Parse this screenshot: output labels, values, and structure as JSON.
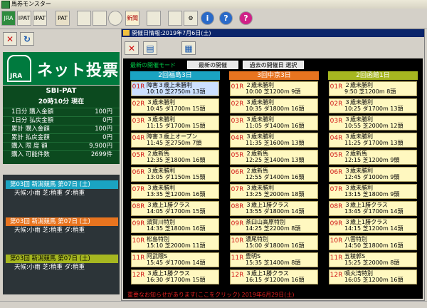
{
  "window": {
    "title": "馬券モンスター"
  },
  "toolbar": {
    "items": [
      {
        "name": "jra-icon",
        "label": "JRA"
      },
      {
        "name": "ipat-icon",
        "label": "IPAT"
      },
      {
        "name": "ipat2-icon",
        "label": "IPAT"
      },
      {
        "name": "pat-icon",
        "label": "PAT"
      },
      {
        "name": "stamp-icon",
        "label": ""
      },
      {
        "name": "printer-icon",
        "label": ""
      },
      {
        "name": "clock-icon",
        "label": ""
      },
      {
        "name": "newspaper-icon",
        "label": "新聞"
      },
      {
        "name": "camera-icon",
        "label": ""
      },
      {
        "name": "save-disk-icon",
        "label": ""
      },
      {
        "name": "gear-icon",
        "label": ""
      },
      {
        "name": "info-icon",
        "label": "i"
      },
      {
        "name": "help-icon",
        "label": "?"
      }
    ]
  },
  "brand": {
    "logo": "JRA",
    "title": "ネット投票"
  },
  "account": {
    "name": "SBI-PAT",
    "time": "20時10分 現在",
    "rows": [
      {
        "label": "1日分 購入金額",
        "value": "100円"
      },
      {
        "label": "1日分 払戻金額",
        "value": "0円"
      },
      {
        "label": "累計 購入金額",
        "value": "100円"
      },
      {
        "label": "累計 払戻金額",
        "value": "0円"
      },
      {
        "label": "購入 限 度 額",
        "value": "9,900円"
      },
      {
        "label": "購入 可能件数",
        "value": "2699件"
      }
    ]
  },
  "racecards": [
    {
      "title": "第03回 新潟競馬 第07日 (土)",
      "weather": "天候:小雨 芝:稍重 ダ:稍重"
    },
    {
      "title": "第03回 新潟競馬 第07日 (土)",
      "weather": "天候:小雨 芝:稍重 ダ:稍重"
    },
    {
      "title": "第03回 新潟競馬 第07日 (土)",
      "weather": "天候:小雨 芝:稍重 ダ:稍重"
    }
  ],
  "child": {
    "title": "開催日情報:2019年7月6日(土)",
    "mode_label": "最新の開催モード",
    "btn_latest": "最新の開催",
    "btn_past": "過去の開催日 選択",
    "notice": "重要なお知らせがあります(ここをクリック) 2019年6月29日(土)"
  },
  "colors": {
    "venue1": "#1aa3c2",
    "venue2": "#e8741f",
    "venue3": "#a6b720",
    "board": "#000000",
    "race_bg": "#fff8c0"
  },
  "venues": [
    {
      "name": "2回福島3日",
      "races": [
        {
          "no": "01R",
          "name": "障害３歳上未勝利",
          "info": "10:10 芝2750m 13頭"
        },
        {
          "no": "02R",
          "name": "３歳未勝利",
          "info": "10:45 ダ1700m 15頭"
        },
        {
          "no": "03R",
          "name": "３歳未勝利",
          "info": "11:15 ダ1700m 15頭"
        },
        {
          "no": "04R",
          "name": "障害３歳上オープン",
          "info": "11:45 芝2750m 7頭"
        },
        {
          "no": "05R",
          "name": "２歳新馬",
          "info": "12:35 芝1800m 16頭"
        },
        {
          "no": "06R",
          "name": "３歳未勝利",
          "info": "13:05 ダ1150m 15頭"
        },
        {
          "no": "07R",
          "name": "３歳未勝利",
          "info": "13:35 芝1200m 16頭"
        },
        {
          "no": "08R",
          "name": "３歳上1勝クラス",
          "info": "14:05 ダ1700m 15頭"
        },
        {
          "no": "09R",
          "name": "須賀川特別",
          "info": "14:35 芝1800m 16頭"
        },
        {
          "no": "10R",
          "name": "松島特別",
          "info": "15:10 芝2000m 11頭"
        },
        {
          "no": "11R",
          "name": "阿武隈S",
          "info": "15:45 ダ1700m 14頭"
        },
        {
          "no": "12R",
          "name": "３歳上1勝クラス",
          "info": "16:30 ダ1700m 15頭"
        }
      ]
    },
    {
      "name": "3回中京3日",
      "races": [
        {
          "no": "01R",
          "name": "２歳未勝利",
          "info": "10:00 芝1200m 9頭"
        },
        {
          "no": "02R",
          "name": "３歳未勝利",
          "info": "10:35 ダ1800m 16頭"
        },
        {
          "no": "03R",
          "name": "３歳未勝利",
          "info": "11:05 ダ1400m 16頭"
        },
        {
          "no": "04R",
          "name": "３歳未勝利",
          "info": "11:35 芝1600m 13頭"
        },
        {
          "no": "05R",
          "name": "２歳新馬",
          "info": "12:25 芝1400m 13頭"
        },
        {
          "no": "06R",
          "name": "２歳新馬",
          "info": "12:55 ダ1400m 16頭"
        },
        {
          "no": "07R",
          "name": "３歳未勝利",
          "info": "13:25 芝2000m 18頭"
        },
        {
          "no": "08R",
          "name": "３歳上1勝クラス",
          "info": "13:55 ダ1800m 14頭"
        },
        {
          "no": "09R",
          "name": "茶臼山高原特別",
          "info": "14:25 芝2200m 8頭"
        },
        {
          "no": "10R",
          "name": "濃尾特別",
          "info": "15:00 ダ1800m 16頭"
        },
        {
          "no": "11R",
          "name": "豊明S",
          "info": "15:35 芝1400m 8頭"
        },
        {
          "no": "12R",
          "name": "３歳上1勝クラス",
          "info": "16:15 ダ1200m 16頭"
        }
      ]
    },
    {
      "name": "2回函館1日",
      "races": [
        {
          "no": "01R",
          "name": "２歳未勝利",
          "info": "9:50 芝1200m 8頭"
        },
        {
          "no": "02R",
          "name": "３歳未勝利",
          "info": "10:25 ダ1700m 13頭"
        },
        {
          "no": "03R",
          "name": "３歳未勝利",
          "info": "10:55 芝2000m 12頭"
        },
        {
          "no": "04R",
          "name": "３歳未勝利",
          "info": "11:25 ダ1700m 13頭"
        },
        {
          "no": "05R",
          "name": "２歳新馬",
          "info": "12:15 芝1200m 9頭"
        },
        {
          "no": "06R",
          "name": "３歳未勝利",
          "info": "12:45 ダ1000m 9頭"
        },
        {
          "no": "07R",
          "name": "３歳未勝利",
          "info": "13:15 芝1800m 9頭"
        },
        {
          "no": "08R",
          "name": "３歳上1勝クラス",
          "info": "13:45 ダ1700m 14頭"
        },
        {
          "no": "09R",
          "name": "３歳上1勝クラス",
          "info": "14:15 芝1200m 14頭"
        },
        {
          "no": "10R",
          "name": "八雲特別",
          "info": "14:50 芝1800m 16頭"
        },
        {
          "no": "11R",
          "name": "五稜郭S",
          "info": "15:25 芝2000m 8頭"
        },
        {
          "no": "12R",
          "name": "噴火湾特別",
          "info": "16:05 芝1200m 16頭"
        }
      ]
    }
  ]
}
